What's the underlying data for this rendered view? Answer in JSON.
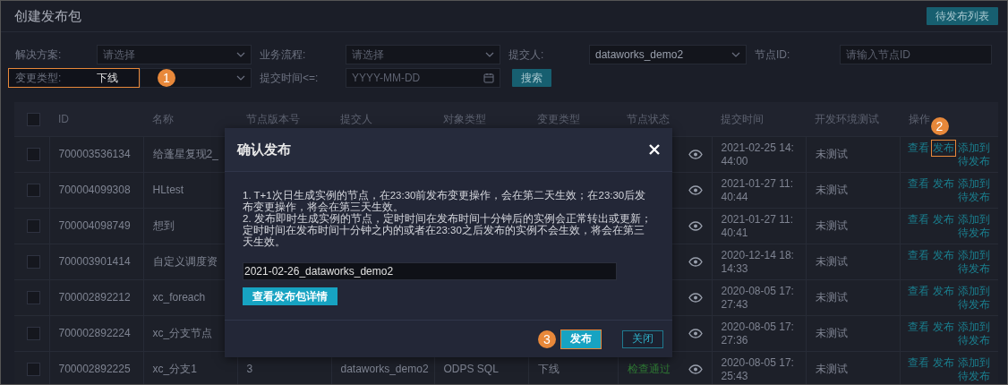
{
  "page": {
    "title": "创建发布包",
    "pending_list_button": "待发布列表"
  },
  "filter_rows": [
    [
      {
        "label": "解决方案:",
        "kind": "select",
        "placeholder": "请选择"
      },
      {
        "label": "业务流程:",
        "kind": "select",
        "placeholder": "请选择"
      },
      {
        "label": "提交人:",
        "kind": "select",
        "value": "dataworks_demo2"
      },
      {
        "label": "节点ID:",
        "kind": "input",
        "placeholder": "请输入节点ID"
      }
    ],
    [
      {
        "label": "变更类型:",
        "kind": "select",
        "value": "下线",
        "highlight": true,
        "marker": "1"
      },
      {
        "label": "提交时间<=:",
        "kind": "date",
        "placeholder": "YYYY-MM-DD"
      },
      {
        "label": "搜索",
        "kind": "button"
      }
    ]
  ],
  "table": {
    "all_checked": false,
    "columns": [
      "ID",
      "名称",
      "节点版本号",
      "提交人",
      "对象类型",
      "变更类型",
      "节点状态",
      "提交时间",
      "开发环境测试",
      "操作"
    ],
    "rows": [
      {
        "checked": false,
        "id": "700003536134",
        "name": "给蓬星复现2_",
        "time": "2021-02-25 14:44:00",
        "test": "未测试",
        "actions": [
          {
            "label": "查看",
            "highlight": false
          },
          {
            "label": "发布",
            "highlight": true,
            "marker": "2"
          },
          {
            "label": "添加到待发布",
            "highlight": false
          }
        ]
      },
      {
        "checked": false,
        "id": "700004099308",
        "name": "HLtest",
        "time": "2021-01-27 11:40:44",
        "test": "未测试",
        "actions": [
          {
            "label": "查看",
            "highlight": false
          },
          {
            "label": "发布",
            "highlight": false
          },
          {
            "label": "添加到待发布",
            "highlight": false
          }
        ]
      },
      {
        "checked": false,
        "id": "700004098749",
        "name": "想到",
        "time": "2021-01-27 11:40:41",
        "test": "未测试",
        "actions": [
          {
            "label": "查看",
            "highlight": false
          },
          {
            "label": "发布",
            "highlight": false
          },
          {
            "label": "添加到待发布",
            "highlight": false
          }
        ]
      },
      {
        "checked": false,
        "id": "700003901414",
        "name": "自定义调度资",
        "time": "2020-12-14 18:14:33",
        "test": "未测试",
        "actions": [
          {
            "label": "查看",
            "highlight": false
          },
          {
            "label": "发布",
            "highlight": false
          },
          {
            "label": "添加到待发布",
            "highlight": false
          }
        ]
      },
      {
        "checked": false,
        "id": "700002892212",
        "name": "xc_foreach",
        "time": "2020-08-05 17:27:43",
        "test": "未测试",
        "actions": [
          {
            "label": "查看",
            "highlight": false
          },
          {
            "label": "发布",
            "highlight": false
          },
          {
            "label": "添加到待发布",
            "highlight": false
          }
        ]
      },
      {
        "checked": false,
        "id": "700002892224",
        "name": "xc_分支节点",
        "time": "2020-08-05 17:27:36",
        "test": "未测试",
        "actions": [
          {
            "label": "查看",
            "highlight": false
          },
          {
            "label": "发布",
            "highlight": false
          },
          {
            "label": "添加到待发布",
            "highlight": false
          }
        ]
      },
      {
        "checked": false,
        "id": "700002892225",
        "name": "xc_分支1",
        "version": "3",
        "submitter": "dataworks_demo2",
        "object_type": "ODPS SQL",
        "change_type": "下线",
        "status": "检查通过",
        "time": "2020-08-05 17:25:43",
        "test": "未测试",
        "actions": [
          {
            "label": "查看",
            "highlight": false
          },
          {
            "label": "发布",
            "highlight": false
          },
          {
            "label": "添加到待发布",
            "highlight": false
          }
        ]
      }
    ]
  },
  "modal": {
    "title": "确认发布",
    "notes": [
      "1. T+1次日生成实例的节点，在23:30前发布变更操作，会在第二天生效；在23:30后发布变更操作，将会在第三天生效。",
      "2. 发布即时生成实例的节点，定时时间在发布时间十分钟后的实例会正常转出或更新；定时时间在发布时间十分钟之内的或者在23:30之后发布的实例不会生效，将会在第三天生效。"
    ],
    "package_name": "2021-02-26_dataworks_demo2",
    "details_button": "查看发布包详情",
    "buttons": [
      {
        "label": "发布",
        "kind": "primary",
        "highlight": true,
        "marker": "3"
      },
      {
        "label": "关闭",
        "kind": "secondary",
        "highlight": false
      }
    ]
  }
}
